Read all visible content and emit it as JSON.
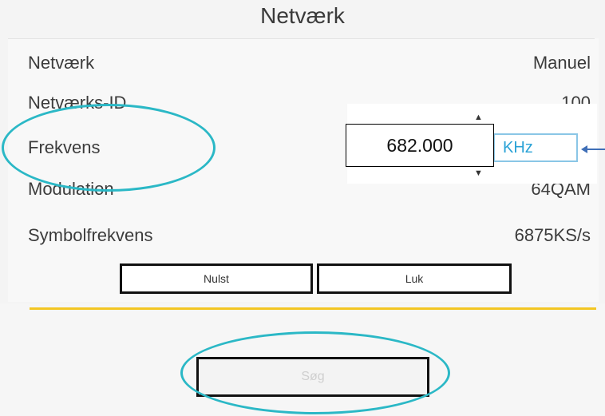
{
  "dialog": {
    "title": "Netværk"
  },
  "rows": [
    {
      "label": "Netværk",
      "value": "Manuel"
    },
    {
      "label": "Netværks-ID",
      "value": "100"
    },
    {
      "label": "Frekvens",
      "value": ""
    },
    {
      "label": "Modulation",
      "value": "64QAM"
    },
    {
      "label": "Symbolfrekvens",
      "value": "6875KS/s"
    }
  ],
  "frequency": {
    "value": "682.000",
    "unit": "KHz"
  },
  "buttons": {
    "reset": "Nulst",
    "close": "Luk",
    "search": "Søg"
  },
  "colors": {
    "highlight": "#2bb8c6",
    "accent": "#f3c623",
    "unit_text": "#2aa2d6",
    "arrow": "#3f6fb7"
  }
}
